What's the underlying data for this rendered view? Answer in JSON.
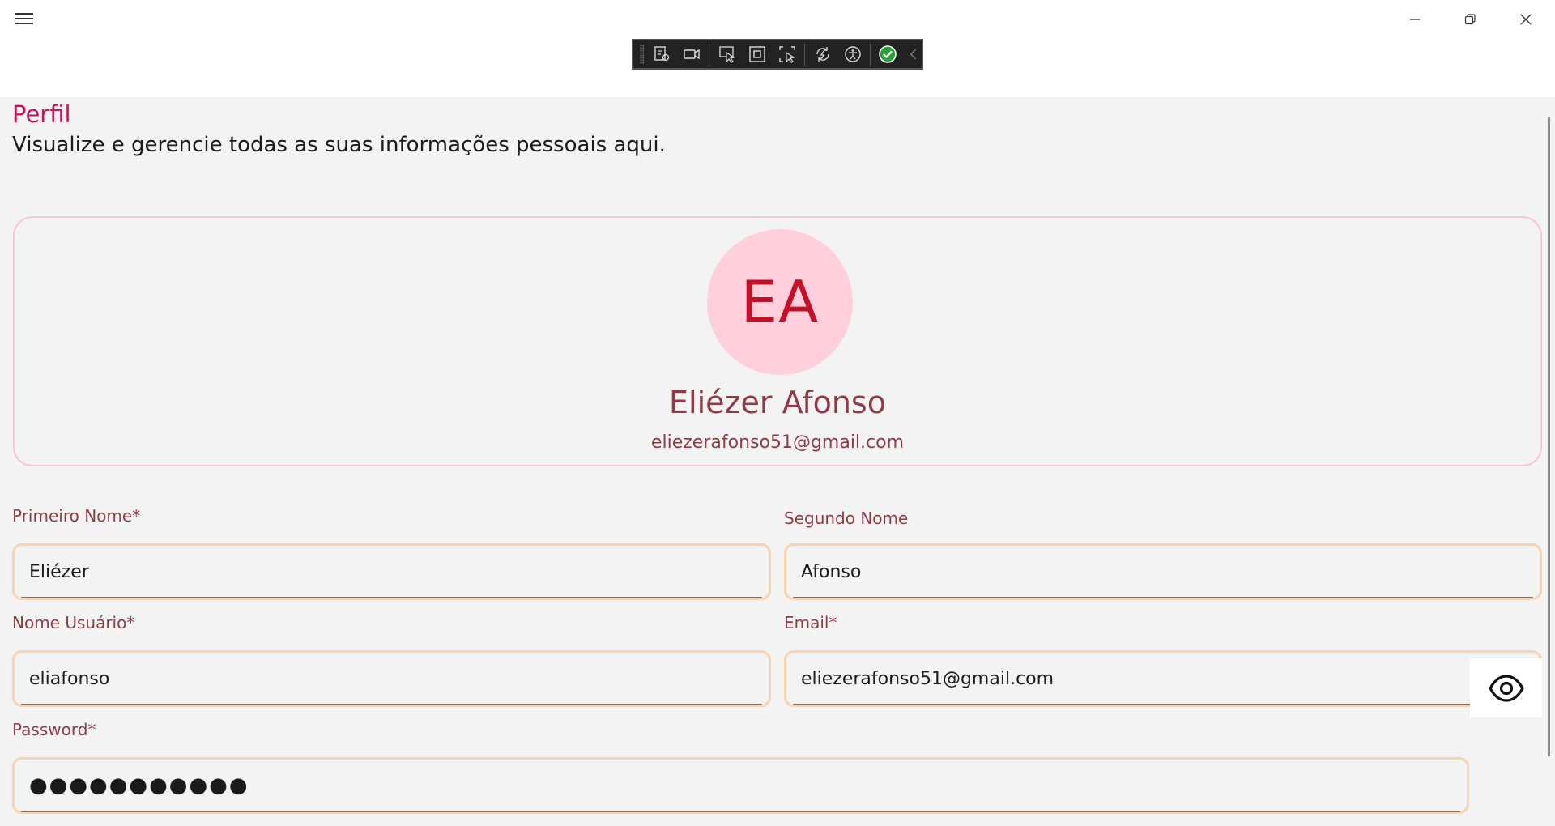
{
  "window": {
    "menu_icon": "hamburger-menu-icon",
    "minimize_icon": "minimize-icon",
    "restore_icon": "restore-icon",
    "close_icon": "close-icon"
  },
  "devtools": {
    "tools": [
      "live-visual-tree-icon",
      "record-icon",
      "select-element-icon",
      "display-layout-adorners-icon",
      "track-focus-icon",
      "hot-reload-icon",
      "accessibility-icon",
      "binding-status-check-icon",
      "collapse-chevron-icon"
    ],
    "status_color": "#2e9e3e"
  },
  "header": {
    "title": "Perfil",
    "subtitle": "Visualize e gerencie todas as suas informações pessoais aqui."
  },
  "profile": {
    "initials": "EA",
    "name": "Eliézer Afonso",
    "email": "eliezerafonso51@gmail.com"
  },
  "form": {
    "first_name": {
      "label": "Primeiro Nome*",
      "value": "Eliézer"
    },
    "last_name": {
      "label": "Segundo Nome",
      "value": "Afonso"
    },
    "username": {
      "label": "Nome Usuário*",
      "value": "eliafonso"
    },
    "email": {
      "label": "Email*",
      "value": "eliezerafonso51@gmail.com"
    },
    "password": {
      "label": "Password*",
      "value": "●●●●●●●●●●●",
      "toggle_icon": "eye-icon"
    }
  },
  "colors": {
    "accent": "#c2185b",
    "avatar_bg": "#ffd0db",
    "avatar_text": "#c2102b",
    "label": "#8e3b46",
    "field_border": "#f8d3b0",
    "card_border": "#f7c6d3"
  }
}
